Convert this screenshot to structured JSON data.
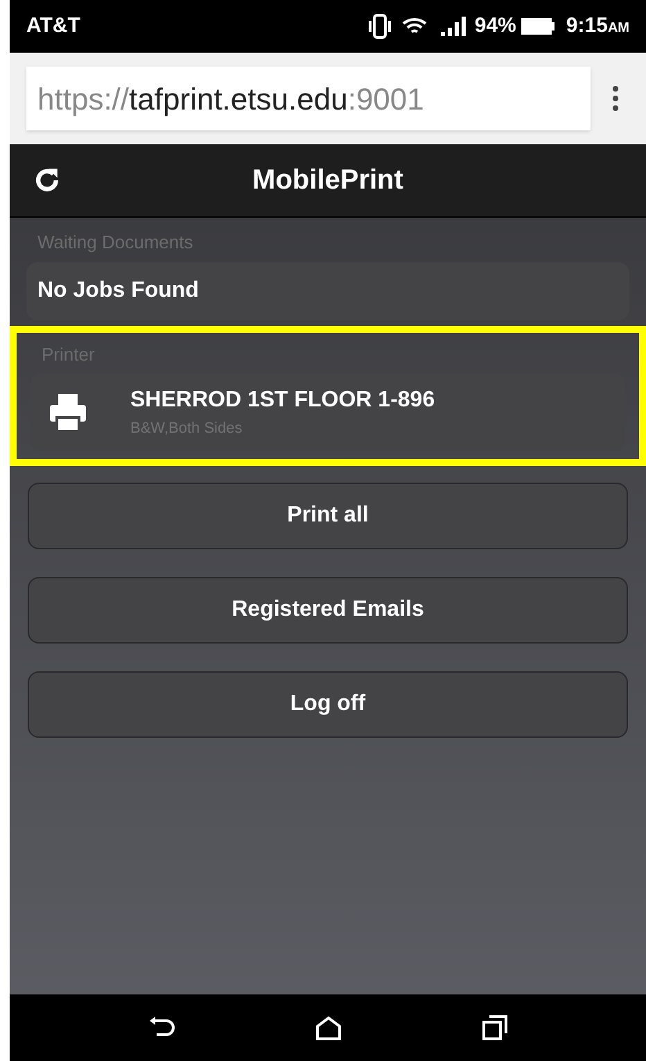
{
  "status_bar": {
    "carrier": "AT&T",
    "battery": "94%",
    "time": "9:15",
    "ampm": "AM"
  },
  "address_bar": {
    "scheme": "https://",
    "host": "tafprint.etsu.edu",
    "port": ":9001"
  },
  "header": {
    "title": "MobilePrint"
  },
  "waiting": {
    "label": "Waiting Documents",
    "value": "No Jobs Found"
  },
  "printer": {
    "label": "Printer",
    "name": "SHERROD 1ST FLOOR 1-896",
    "details": "B&W,Both Sides",
    "highlighted": true
  },
  "buttons": [
    "Print all",
    "Registered Emails",
    "Log off"
  ]
}
